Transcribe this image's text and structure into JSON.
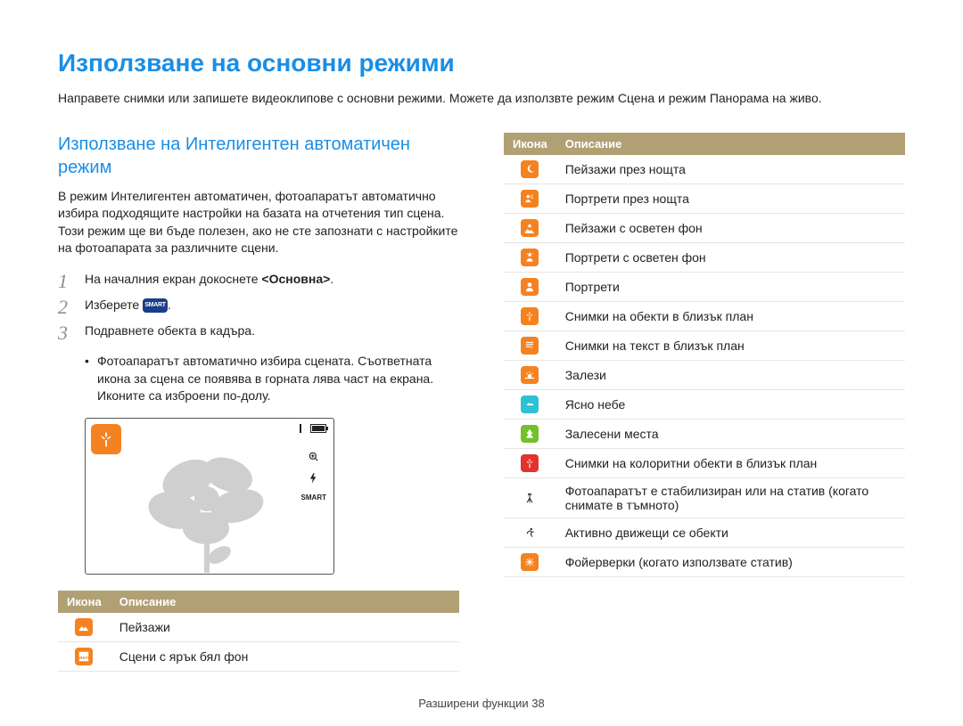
{
  "title": "Използване на основни режими",
  "intro": "Направете снимки или запишете видеоклипове с основни режими. Можете да използвте режим Сцена и режим Панорама на живо.",
  "section": {
    "heading": "Използване на Интелигентен автоматичен режим",
    "para": "В режим Интелигентен автоматичен, фотоапаратът автоматично избира подходящите настройки на базата на отчетения тип сцена. Този режим ще ви бъде полезен, ако не сте запознати с настройките на фотоапарата за различните сцени."
  },
  "steps": {
    "s1_pre": "На началния екран докоснете ",
    "s1_bold": "<Основна>",
    "s1_post": ".",
    "s2_pre": "Изберете ",
    "s2_chip": "SMART",
    "s2_post": ".",
    "s3": "Подравнете обекта в кадъра.",
    "s3_sub": "Фотоапаратът автоматично избира сцената. Съответната икона за сцена се появява в горната лява част на екрана. Иконите са изброени по-долу."
  },
  "table": {
    "head_icon": "Икона",
    "head_desc": "Описание"
  },
  "icons_left": [
    {
      "name": "landscape-icon",
      "bg": "#f58220",
      "desc": "Пейзажи"
    },
    {
      "name": "white-bg-icon",
      "bg": "#f58220",
      "desc": "Сцени с ярък бял фон"
    }
  ],
  "icons_right": [
    {
      "name": "night-landscape-icon",
      "bg": "#f58220",
      "desc": "Пейзажи през нощта"
    },
    {
      "name": "night-portrait-icon",
      "bg": "#f58220",
      "desc": "Портрети през нощта"
    },
    {
      "name": "backlit-landscape-icon",
      "bg": "#f58220",
      "desc": "Пейзажи с осветен фон"
    },
    {
      "name": "backlit-portrait-icon",
      "bg": "#f58220",
      "desc": "Портрети с осветен фон"
    },
    {
      "name": "portrait-icon",
      "bg": "#f58220",
      "desc": "Портрети"
    },
    {
      "name": "macro-icon",
      "bg": "#f58220",
      "desc": "Снимки на обекти в близък план"
    },
    {
      "name": "macro-text-icon",
      "bg": "#f58220",
      "desc": "Снимки на текст в близък план"
    },
    {
      "name": "sunset-icon",
      "bg": "#f58220",
      "desc": "Залези"
    },
    {
      "name": "clear-sky-icon",
      "bg": "#2fc0d6",
      "desc": "Ясно небе"
    },
    {
      "name": "greenery-icon",
      "bg": "#73c02c",
      "desc": "Залесени места"
    },
    {
      "name": "macro-color-icon",
      "bg": "#e2332f",
      "desc": "Снимки на колоритни обекти в близък план"
    },
    {
      "name": "tripod-icon",
      "bg": "transparent",
      "desc": "Фотоапаратът е стабилизиран или на статив (когато снимате в тъмното)"
    },
    {
      "name": "action-icon",
      "bg": "transparent",
      "desc": "Активно движещи се обекти"
    },
    {
      "name": "fireworks-icon",
      "bg": "#f58220",
      "desc": "Фойерверки (когато използвате статив)"
    }
  ],
  "footer": "Разширени функции  38"
}
